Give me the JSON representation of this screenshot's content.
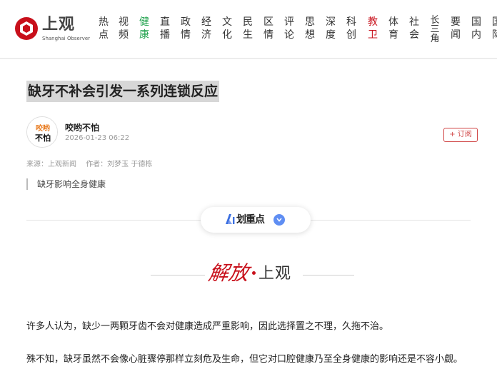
{
  "site": {
    "logo_cn": "上观",
    "logo_en": "Shanghai Observer",
    "brand_color": "#c8101b"
  },
  "nav": {
    "items": [
      {
        "label": "热点"
      },
      {
        "label": "视频"
      },
      {
        "label": "健康",
        "active": "green"
      },
      {
        "label": "直播"
      },
      {
        "label": "政情"
      },
      {
        "label": "经济"
      },
      {
        "label": "文化"
      },
      {
        "label": "民生"
      },
      {
        "label": "区情"
      },
      {
        "label": "评论"
      },
      {
        "label": "思想"
      },
      {
        "label": "深度"
      },
      {
        "label": "科创"
      },
      {
        "label": "教卫",
        "active": "red"
      },
      {
        "label": "体育"
      },
      {
        "label": "社会"
      },
      {
        "label": "长三角"
      },
      {
        "label": "要闻"
      },
      {
        "label": "国内"
      },
      {
        "label": "国际"
      }
    ]
  },
  "article": {
    "title": "缺牙不补会引发一系列连锁反应",
    "author": {
      "name": "咬哟不怕",
      "avatar_text_top": "咬哟",
      "avatar_text_bottom": "不怕",
      "time": "2026-01-23 06:22"
    },
    "subscribe_label": "+ 订阅",
    "source_label": "来源：上观新闻",
    "authors_label": "作者：刘梦玉 于德栋",
    "summary": "缺牙影响全身健康",
    "ai_button_label": "划重点",
    "brand_script": "解放",
    "brand_name": "上观",
    "paragraphs": [
      "许多人认为，缺少一两颗牙齿不会对健康造成严重影响，因此选择置之不理，久拖不治。",
      "殊不知，缺牙虽然不会像心脏骤停那样立刻危及生命，但它对口腔健康乃至全身健康的影响还是不容小觑。"
    ]
  }
}
